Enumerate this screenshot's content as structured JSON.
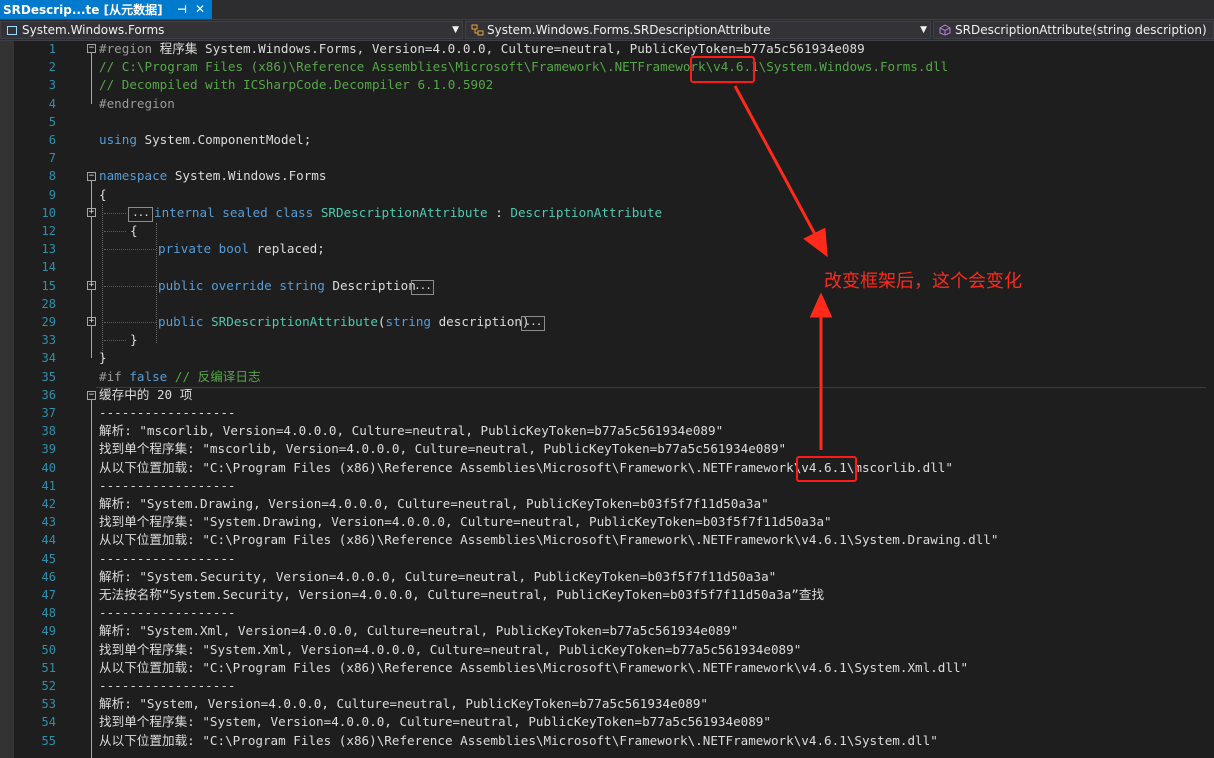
{
  "tab": {
    "title": "SRDescrip...te [从元数据]",
    "pin_icon": "pin-icon",
    "close_icon": "close-icon"
  },
  "navbar": {
    "project": "System.Windows.Forms",
    "type": "System.Windows.Forms.SRDescriptionAttribute",
    "member": "SRDescriptionAttribute(string description)"
  },
  "line_numbers": [
    "1",
    "2",
    "3",
    "4",
    "5",
    "6",
    "7",
    "8",
    "9",
    "10",
    "12",
    "13",
    "14",
    "15",
    "28",
    "29",
    "33",
    "34",
    "35",
    "36",
    "37",
    "38",
    "39",
    "40",
    "41",
    "42",
    "43",
    "44",
    "45",
    "46",
    "47",
    "48",
    "49",
    "50",
    "51",
    "52",
    "53",
    "54",
    "55"
  ],
  "code_lines": [
    [
      {
        "c": "pp",
        "t": "#region "
      },
      {
        "c": "plain",
        "t": "程序集 System.Windows.Forms, Version=4.0.0.0, Culture=neutral, PublicKeyToken=b77a5c561934e089"
      }
    ],
    [
      {
        "c": "cm",
        "t": "// C:\\Program Files (x86)\\Reference Assemblies\\Microsoft\\Framework\\.NETFramework\\v4.6.1\\System.Windows.Forms.dll"
      }
    ],
    [
      {
        "c": "cm",
        "t": "// Decompiled with ICSharpCode.Decompiler 6.1.0.5902"
      }
    ],
    [
      {
        "c": "pp",
        "t": "#endregion"
      }
    ],
    [],
    [
      {
        "c": "kw",
        "t": "using"
      },
      {
        "c": "plain",
        "t": " System.ComponentModel;"
      }
    ],
    [],
    [
      {
        "c": "kw",
        "t": "namespace"
      },
      {
        "c": "plain",
        "t": " System.Windows.Forms"
      }
    ],
    [
      {
        "c": "plain",
        "t": "{"
      }
    ],
    [
      {
        "c": "kw",
        "t": "internal sealed class"
      },
      {
        "c": "plain",
        "t": " "
      },
      {
        "c": "ty",
        "t": "SRDescriptionAttribute"
      },
      {
        "c": "plain",
        "t": " : "
      },
      {
        "c": "ty",
        "t": "DescriptionAttribute"
      }
    ],
    [
      {
        "c": "plain",
        "t": "{"
      }
    ],
    [
      {
        "c": "kw",
        "t": "private bool"
      },
      {
        "c": "plain",
        "t": " replaced;"
      }
    ],
    [],
    [
      {
        "c": "kw",
        "t": "public override string"
      },
      {
        "c": "plain",
        "t": " Description"
      }
    ],
    [],
    [
      {
        "c": "kw",
        "t": "public"
      },
      {
        "c": "plain",
        "t": " "
      },
      {
        "c": "ty",
        "t": "SRDescriptionAttribute"
      },
      {
        "c": "plain",
        "t": "("
      },
      {
        "c": "kw",
        "t": "string"
      },
      {
        "c": "plain",
        "t": " description)"
      }
    ],
    [
      {
        "c": "plain",
        "t": "}"
      }
    ],
    [
      {
        "c": "plain",
        "t": "}"
      }
    ],
    [
      {
        "c": "pp",
        "t": "#if "
      },
      {
        "c": "kw",
        "t": "false"
      },
      {
        "c": "plain",
        "t": " "
      },
      {
        "c": "cm",
        "t": "// 反编译日志"
      }
    ],
    [
      {
        "c": "plain",
        "t": "缓存中的 20 项"
      }
    ],
    [
      {
        "c": "plain",
        "t": "------------------"
      }
    ],
    [
      {
        "c": "plain",
        "t": "解析: \"mscorlib, Version=4.0.0.0, Culture=neutral, PublicKeyToken=b77a5c561934e089\""
      }
    ],
    [
      {
        "c": "plain",
        "t": "找到单个程序集: \"mscorlib, Version=4.0.0.0, Culture=neutral, PublicKeyToken=b77a5c561934e089\""
      }
    ],
    [
      {
        "c": "plain",
        "t": "从以下位置加载: \"C:\\Program Files (x86)\\Reference Assemblies\\Microsoft\\Framework\\.NETFramework\\v4.6.1\\mscorlib.dll\""
      }
    ],
    [
      {
        "c": "plain",
        "t": "------------------"
      }
    ],
    [
      {
        "c": "plain",
        "t": "解析: \"System.Drawing, Version=4.0.0.0, Culture=neutral, PublicKeyToken=b03f5f7f11d50a3a\""
      }
    ],
    [
      {
        "c": "plain",
        "t": "找到单个程序集: \"System.Drawing, Version=4.0.0.0, Culture=neutral, PublicKeyToken=b03f5f7f11d50a3a\""
      }
    ],
    [
      {
        "c": "plain",
        "t": "从以下位置加载: \"C:\\Program Files (x86)\\Reference Assemblies\\Microsoft\\Framework\\.NETFramework\\v4.6.1\\System.Drawing.dll\""
      }
    ],
    [
      {
        "c": "plain",
        "t": "------------------"
      }
    ],
    [
      {
        "c": "plain",
        "t": "解析: \"System.Security, Version=4.0.0.0, Culture=neutral, PublicKeyToken=b03f5f7f11d50a3a\""
      }
    ],
    [
      {
        "c": "plain",
        "t": "无法按名称“System.Security, Version=4.0.0.0, Culture=neutral, PublicKeyToken=b03f5f7f11d50a3a”查找"
      }
    ],
    [
      {
        "c": "plain",
        "t": "------------------"
      }
    ],
    [
      {
        "c": "plain",
        "t": "解析: \"System.Xml, Version=4.0.0.0, Culture=neutral, PublicKeyToken=b77a5c561934e089\""
      }
    ],
    [
      {
        "c": "plain",
        "t": "找到单个程序集: \"System.Xml, Version=4.0.0.0, Culture=neutral, PublicKeyToken=b77a5c561934e089\""
      }
    ],
    [
      {
        "c": "plain",
        "t": "从以下位置加载: \"C:\\Program Files (x86)\\Reference Assemblies\\Microsoft\\Framework\\.NETFramework\\v4.6.1\\System.Xml.dll\""
      }
    ],
    [
      {
        "c": "plain",
        "t": "------------------"
      }
    ],
    [
      {
        "c": "plain",
        "t": "解析: \"System, Version=4.0.0.0, Culture=neutral, PublicKeyToken=b77a5c561934e089\""
      }
    ],
    [
      {
        "c": "plain",
        "t": "找到单个程序集: \"System, Version=4.0.0.0, Culture=neutral, PublicKeyToken=b77a5c561934e089\""
      }
    ],
    [
      {
        "c": "plain",
        "t": "从以下位置加载: \"C:\\Program Files (x86)\\Reference Assemblies\\Microsoft\\Framework\\.NETFramework\\v4.6.1\\System.dll\""
      }
    ]
  ],
  "annotation": {
    "text": "改变框架后，这个会变化",
    "color": "#ff2a1a"
  },
  "colors": {
    "keyword": "#569cd6",
    "type": "#4ec9b0",
    "comment": "#57a64a",
    "line_number": "#2b91af",
    "tab_accent": "#007acc"
  }
}
